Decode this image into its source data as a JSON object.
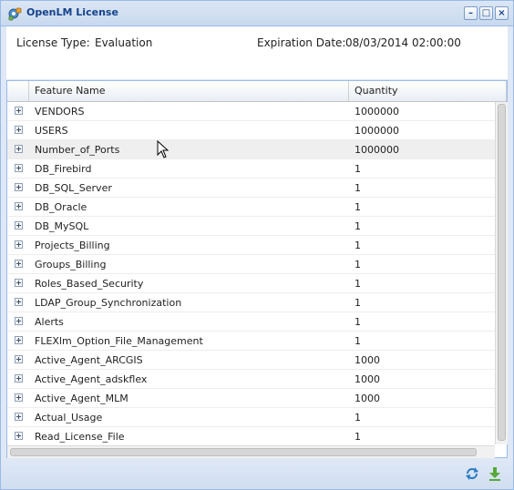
{
  "window": {
    "title": "OpenLM License"
  },
  "license": {
    "type_label": "License Type:",
    "type_value": "Evaluation",
    "expiration_label": "Expiration Date:",
    "expiration_value": "08/03/2014 02:00:00"
  },
  "grid": {
    "columns": [
      "Feature Name",
      "Quantity"
    ],
    "rows": [
      {
        "name": "VENDORS",
        "quantity": "1000000"
      },
      {
        "name": "USERS",
        "quantity": "1000000"
      },
      {
        "name": "Number_of_Ports",
        "quantity": "1000000"
      },
      {
        "name": "DB_Firebird",
        "quantity": "1"
      },
      {
        "name": "DB_SQL_Server",
        "quantity": "1"
      },
      {
        "name": "DB_Oracle",
        "quantity": "1"
      },
      {
        "name": "DB_MySQL",
        "quantity": "1"
      },
      {
        "name": "Projects_Billing",
        "quantity": "1"
      },
      {
        "name": "Groups_Billing",
        "quantity": "1"
      },
      {
        "name": "Roles_Based_Security",
        "quantity": "1"
      },
      {
        "name": "LDAP_Group_Synchronization",
        "quantity": "1"
      },
      {
        "name": "Alerts",
        "quantity": "1"
      },
      {
        "name": "FLEXlm_Option_File_Management",
        "quantity": "1"
      },
      {
        "name": "Active_Agent_ARCGIS",
        "quantity": "1000"
      },
      {
        "name": "Active_Agent_adskflex",
        "quantity": "1000"
      },
      {
        "name": "Active_Agent_MLM",
        "quantity": "1000"
      },
      {
        "name": "Actual_Usage",
        "quantity": "1"
      },
      {
        "name": "Read_License_File",
        "quantity": "1"
      }
    ],
    "highlighted_row": 2
  },
  "icons": {
    "app": "openlm-gear-icon",
    "minimize": "minimize-icon",
    "maximize": "maximize-icon",
    "close": "close-icon",
    "refresh": "refresh-icon",
    "download": "download-icon",
    "expander": "expand-plus-icon"
  },
  "colors": {
    "title_text": "#15428b",
    "window_border": "#99bbe8",
    "panel_bg": "#dfe8f6"
  }
}
